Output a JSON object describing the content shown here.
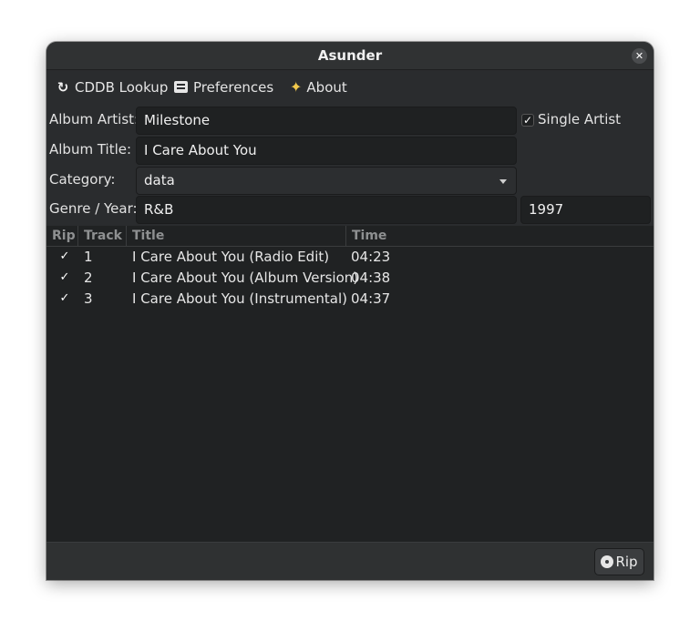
{
  "window": {
    "title": "Asunder"
  },
  "toolbar": {
    "cddb_lookup": "CDDB Lookup",
    "preferences": "Preferences",
    "about": "About"
  },
  "form": {
    "album_artist_label": "Album Artist:",
    "album_artist_value": "Milestone",
    "single_artist_label": "Single Artist",
    "single_artist_checked": true,
    "album_title_label": "Album Title:",
    "album_title_value": "I Care About You",
    "category_label": "Category:",
    "category_value": "data",
    "genre_year_label": "Genre / Year:",
    "genre_value": "R&B",
    "year_value": "1997"
  },
  "tracks": {
    "headers": {
      "rip": "Rip",
      "track": "Track",
      "title": "Title",
      "time": "Time"
    },
    "rows": [
      {
        "rip": true,
        "track": "1",
        "title": "I Care About You (Radio Edit)",
        "time": "04:23"
      },
      {
        "rip": true,
        "track": "2",
        "title": "I Care About You (Album Version)",
        "time": "04:38"
      },
      {
        "rip": true,
        "track": "3",
        "title": "I Care About You (Instrumental)",
        "time": "04:37"
      }
    ]
  },
  "footer": {
    "rip_label": "Rip"
  },
  "icons": {
    "refresh": "refresh-icon",
    "preferences": "preferences-icon",
    "about": "sparkle-icon",
    "disc": "disc-icon",
    "close": "close-icon"
  },
  "colors": {
    "window_bg": "#2a2c2e",
    "entry_bg": "#1f2122",
    "list_bg": "#202223",
    "text": "#e6e6e6",
    "header_text": "#8e9091",
    "star": "#f2c94c"
  }
}
